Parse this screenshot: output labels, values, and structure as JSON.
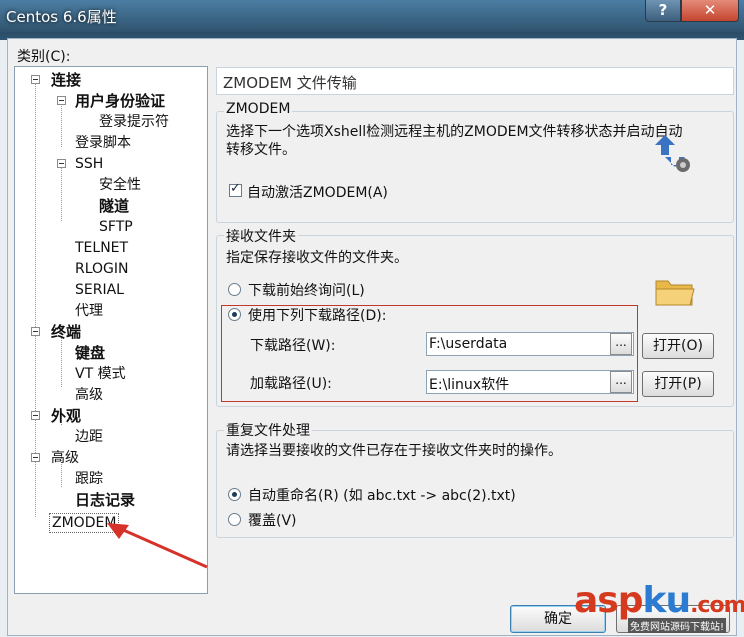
{
  "window": {
    "title": "Centos 6.6属性",
    "help_label": "?",
    "close_label": "✕"
  },
  "category_label": "类别(C):",
  "tree": {
    "connection": "连接",
    "auth": "用户身份验证",
    "login_prompt": "登录提示符",
    "login_script": "登录脚本",
    "ssh": "SSH",
    "security": "安全性",
    "tunnel": "隧道",
    "sftp": "SFTP",
    "telnet": "TELNET",
    "rlogin": "RLOGIN",
    "serial": "SERIAL",
    "proxy": "代理",
    "terminal": "终端",
    "keyboard": "键盘",
    "vt_mode": "VT 模式",
    "advanced": "高级",
    "appearance": "外观",
    "margins": "边距",
    "advanced2": "高级",
    "trace": "跟踪",
    "logging": "日志记录",
    "zmodem": "ZMODEM"
  },
  "panel": {
    "title": "ZMODEM 文件传输",
    "zmodem_group": {
      "label": "ZMODEM",
      "desc_line1": "选择下一个选项Xshell检测远程主机的ZMODEM文件转移状态并启动自动",
      "desc_line2": "转移文件。",
      "auto_activate": "自动激活ZMODEM(A)"
    },
    "receive_group": {
      "label": "接收文件夹",
      "desc": "指定保存接收文件的文件夹。",
      "ask_before": "下载前始终询问(L)",
      "use_path": "使用下列下载路径(D):",
      "download_label": "下载路径(W):",
      "download_value": "F:\\userdata",
      "upload_label": "加载路径(U):",
      "upload_value": "E:\\linux软件",
      "browse": "...",
      "open1": "打开(O)",
      "open2": "打开(P)"
    },
    "dup_group": {
      "label": "重复文件处理",
      "desc": "请选择当要接收的文件已存在于接收文件夹时的操作。",
      "auto_rename": "自动重命名(R) (如 abc.txt -> abc(2).txt)",
      "overwrite": "覆盖(V)"
    }
  },
  "ok_button": "确定",
  "watermark": {
    "asp": "asp",
    "ku": "ku",
    "com": ".com",
    "sub": "免费网站源码下载站!"
  },
  "colors": {
    "accent": "#3c7fb1",
    "red_highlight": "#c0392b"
  }
}
